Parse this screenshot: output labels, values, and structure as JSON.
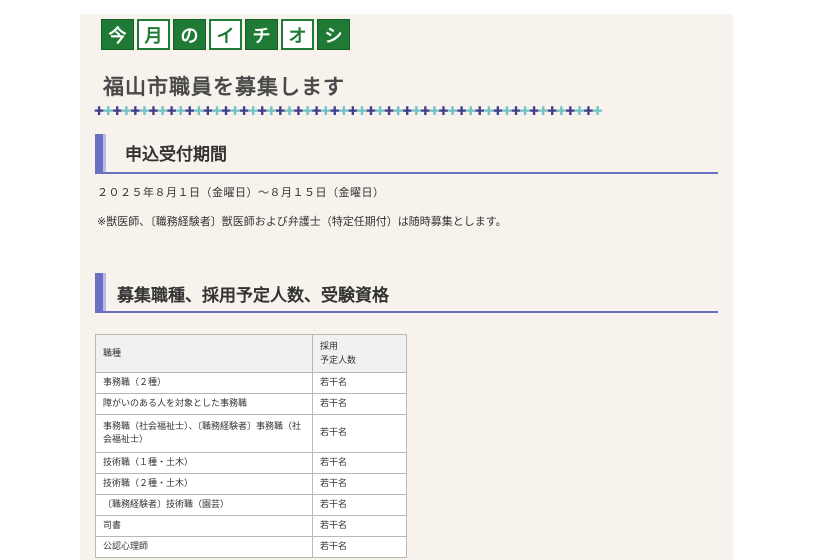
{
  "badge": [
    "今",
    "月",
    "の",
    "イ",
    "チ",
    "オ",
    "シ"
  ],
  "page_title": "福山市職員を募集します",
  "sections": {
    "period_heading": "申込受付期間",
    "period_text": "２０２５年８月１日（金曜日）～８月１５日（金曜日）",
    "period_note": "※獣医師、〔職務経験者〕獣医師および弁護士（特定任期付）は随時募集とします。",
    "jobs_heading": "募集職種、採用予定人数、受験資格"
  },
  "table": {
    "headers": [
      "職種",
      "採用\n予定人数"
    ],
    "rows": [
      [
        "事務職（２種）",
        "若干名"
      ],
      [
        "障がいのある人を対象とした事務職",
        "若干名"
      ],
      [
        "事務職（社会福祉士）、〔職務経験者〕事務職（社会福祉士）",
        "若干名"
      ],
      [
        "技術職（１種・土木）",
        "若干名"
      ],
      [
        "技術職（２種・土木）",
        "若干名"
      ],
      [
        "〔職務経験者〕技術職（園芸）",
        "若干名"
      ],
      [
        "司書",
        "若干名"
      ],
      [
        "公認心理師",
        "若干名"
      ]
    ]
  }
}
